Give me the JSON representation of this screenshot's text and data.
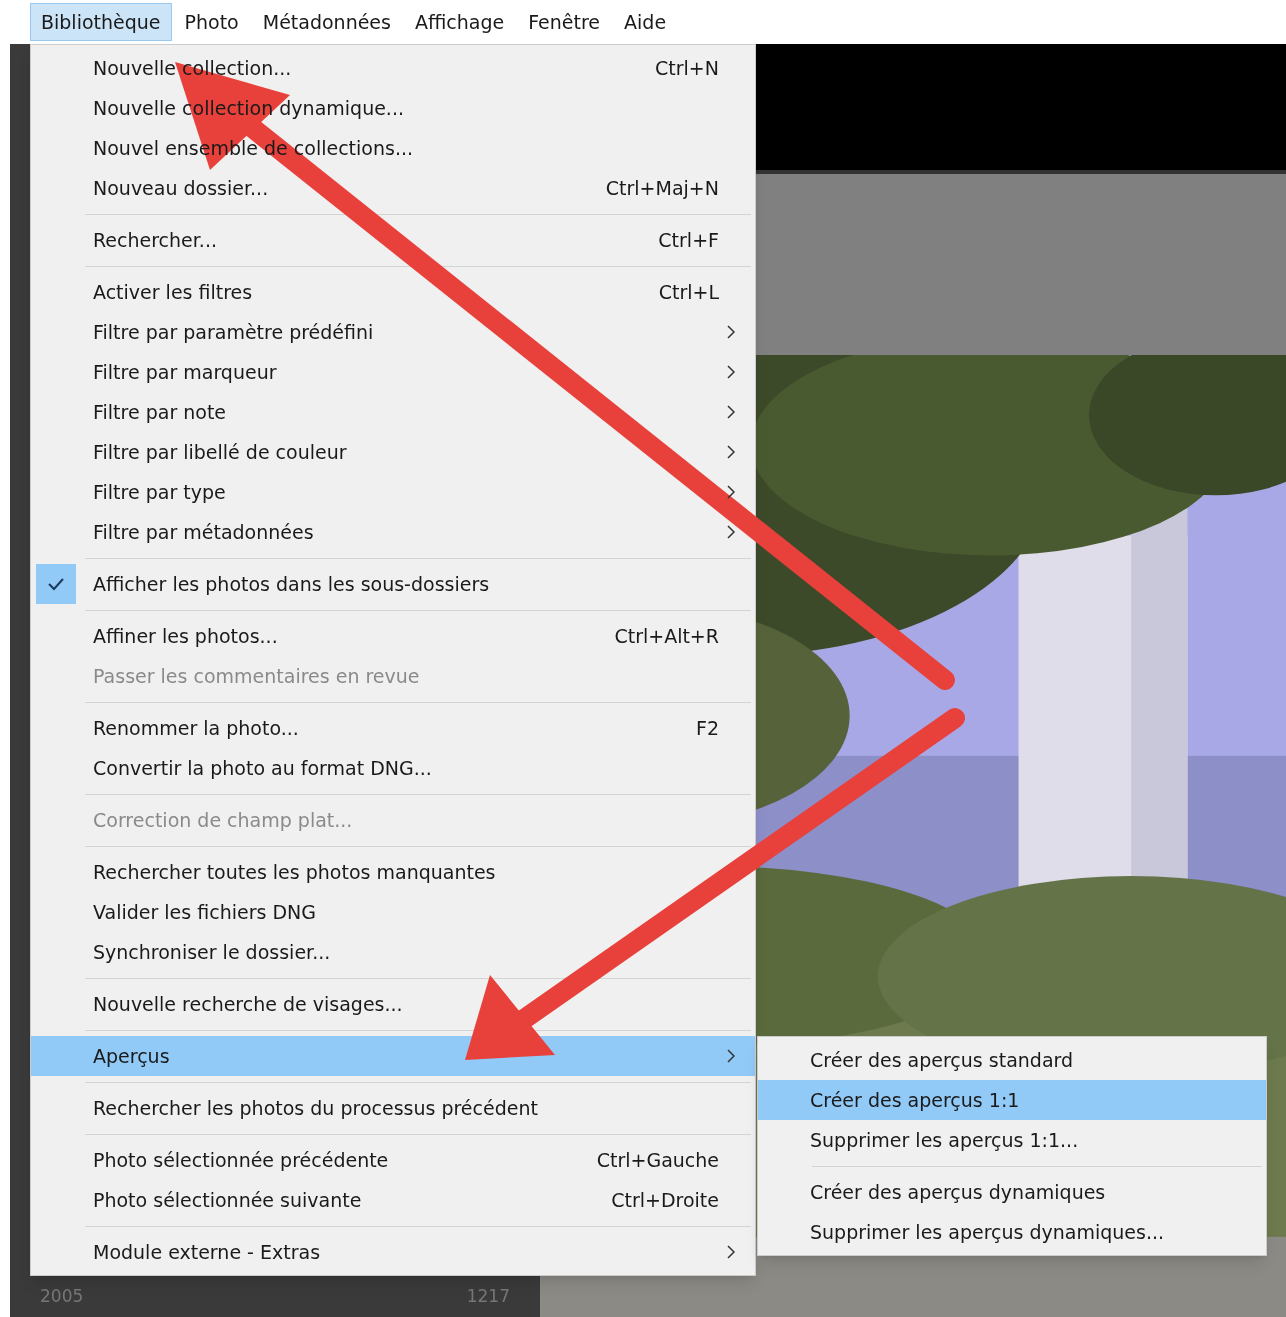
{
  "menubar": [
    {
      "label": "Bibliothèque",
      "selected": true
    },
    {
      "label": "Photo",
      "selected": false
    },
    {
      "label": "Métadonnées",
      "selected": false
    },
    {
      "label": "Affichage",
      "selected": false
    },
    {
      "label": "Fenêtre",
      "selected": false
    },
    {
      "label": "Aide",
      "selected": false
    }
  ],
  "folder_row": {
    "name": "2005",
    "count": "1217"
  },
  "menu": [
    {
      "kind": "item",
      "label": "Nouvelle collection...",
      "shortcut": "Ctrl+N"
    },
    {
      "kind": "item",
      "label": "Nouvelle collection dynamique..."
    },
    {
      "kind": "item",
      "label": "Nouvel ensemble de collections..."
    },
    {
      "kind": "item",
      "label": "Nouveau dossier...",
      "shortcut": "Ctrl+Maj+N"
    },
    {
      "kind": "separator"
    },
    {
      "kind": "item",
      "label": "Rechercher...",
      "shortcut": "Ctrl+F"
    },
    {
      "kind": "separator"
    },
    {
      "kind": "item",
      "label": "Activer les filtres",
      "shortcut": "Ctrl+L"
    },
    {
      "kind": "item",
      "label": "Filtre par paramètre prédéfini",
      "submenu": true
    },
    {
      "kind": "item",
      "label": "Filtre par marqueur",
      "submenu": true
    },
    {
      "kind": "item",
      "label": "Filtre par note",
      "submenu": true
    },
    {
      "kind": "item",
      "label": "Filtre par libellé de couleur",
      "submenu": true
    },
    {
      "kind": "item",
      "label": "Filtre par type",
      "submenu": true
    },
    {
      "kind": "item",
      "label": "Filtre par métadonnées",
      "submenu": true
    },
    {
      "kind": "separator"
    },
    {
      "kind": "item",
      "label": "Afficher les photos dans les sous-dossiers",
      "checked": true
    },
    {
      "kind": "separator"
    },
    {
      "kind": "item",
      "label": "Affiner les photos...",
      "shortcut": "Ctrl+Alt+R"
    },
    {
      "kind": "item",
      "label": "Passer les commentaires en revue",
      "disabled": true
    },
    {
      "kind": "separator"
    },
    {
      "kind": "item",
      "label": "Renommer la photo...",
      "shortcut": "F2"
    },
    {
      "kind": "item",
      "label": "Convertir la photo au format DNG..."
    },
    {
      "kind": "separator"
    },
    {
      "kind": "item",
      "label": "Correction de champ plat...",
      "disabled": true
    },
    {
      "kind": "separator"
    },
    {
      "kind": "item",
      "label": "Rechercher toutes les photos manquantes"
    },
    {
      "kind": "item",
      "label": "Valider les fichiers DNG"
    },
    {
      "kind": "item",
      "label": "Synchroniser le dossier..."
    },
    {
      "kind": "separator"
    },
    {
      "kind": "item",
      "label": "Nouvelle recherche de visages..."
    },
    {
      "kind": "separator"
    },
    {
      "kind": "item",
      "label": "Aperçus",
      "submenu": true,
      "selected": true
    },
    {
      "kind": "separator"
    },
    {
      "kind": "item",
      "label": "Rechercher les photos du processus précédent"
    },
    {
      "kind": "separator"
    },
    {
      "kind": "item",
      "label": "Photo sélectionnée précédente",
      "shortcut": "Ctrl+Gauche"
    },
    {
      "kind": "item",
      "label": "Photo sélectionnée suivante",
      "shortcut": "Ctrl+Droite"
    },
    {
      "kind": "separator"
    },
    {
      "kind": "item",
      "label": "Module externe - Extras",
      "submenu": true
    }
  ],
  "submenu": [
    {
      "kind": "item",
      "label": "Créer des aperçus standard",
      "selected": false
    },
    {
      "kind": "item",
      "label": "Créer des aperçus 1:1",
      "selected": true
    },
    {
      "kind": "item",
      "label": "Supprimer les aperçus 1:1...",
      "selected": false
    },
    {
      "kind": "separator"
    },
    {
      "kind": "item",
      "label": "Créer des aperçus dynamiques",
      "selected": false
    },
    {
      "kind": "item",
      "label": "Supprimer les aperçus dynamiques...",
      "selected": false
    }
  ]
}
